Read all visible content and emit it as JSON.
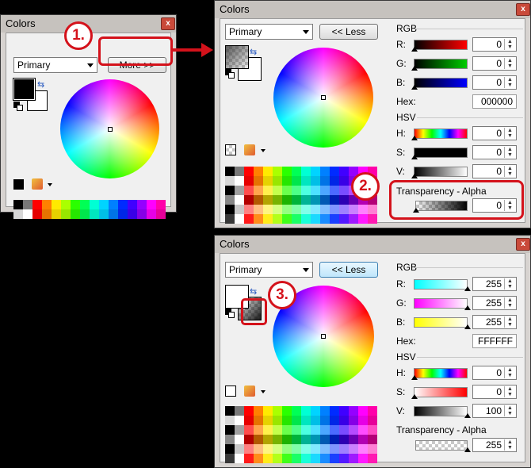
{
  "window_title": "Colors",
  "close_glyph": "x",
  "mode_dropdown": "Primary",
  "more_button": "More >>",
  "less_button": "<< Less",
  "sections": {
    "rgb": "RGB",
    "hsv": "HSV",
    "transparency": "Transparency - Alpha"
  },
  "labels": {
    "r": "R:",
    "g": "G:",
    "b": "B:",
    "hex": "Hex:",
    "h": "H:",
    "s": "S:",
    "v": "V:"
  },
  "state_before": {
    "r": "0",
    "g": "0",
    "b": "0",
    "hex": "000000",
    "h": "0",
    "s": "0",
    "v": "0",
    "alpha": "0"
  },
  "state_after": {
    "r": "255",
    "g": "255",
    "b": "255",
    "hex": "FFFFFF",
    "h": "0",
    "s": "0",
    "v": "100",
    "alpha": "255"
  },
  "annotations": {
    "step1": "1.",
    "step2": "2.",
    "step3": "3."
  },
  "icons": {
    "swap": "swap-arrow-icon",
    "reset": "reset-colors-icon",
    "palette": "palette-menu-icon",
    "close": "close-icon"
  },
  "colors": {
    "callout": "#d4121b",
    "title_bar": "#c6c2be"
  }
}
